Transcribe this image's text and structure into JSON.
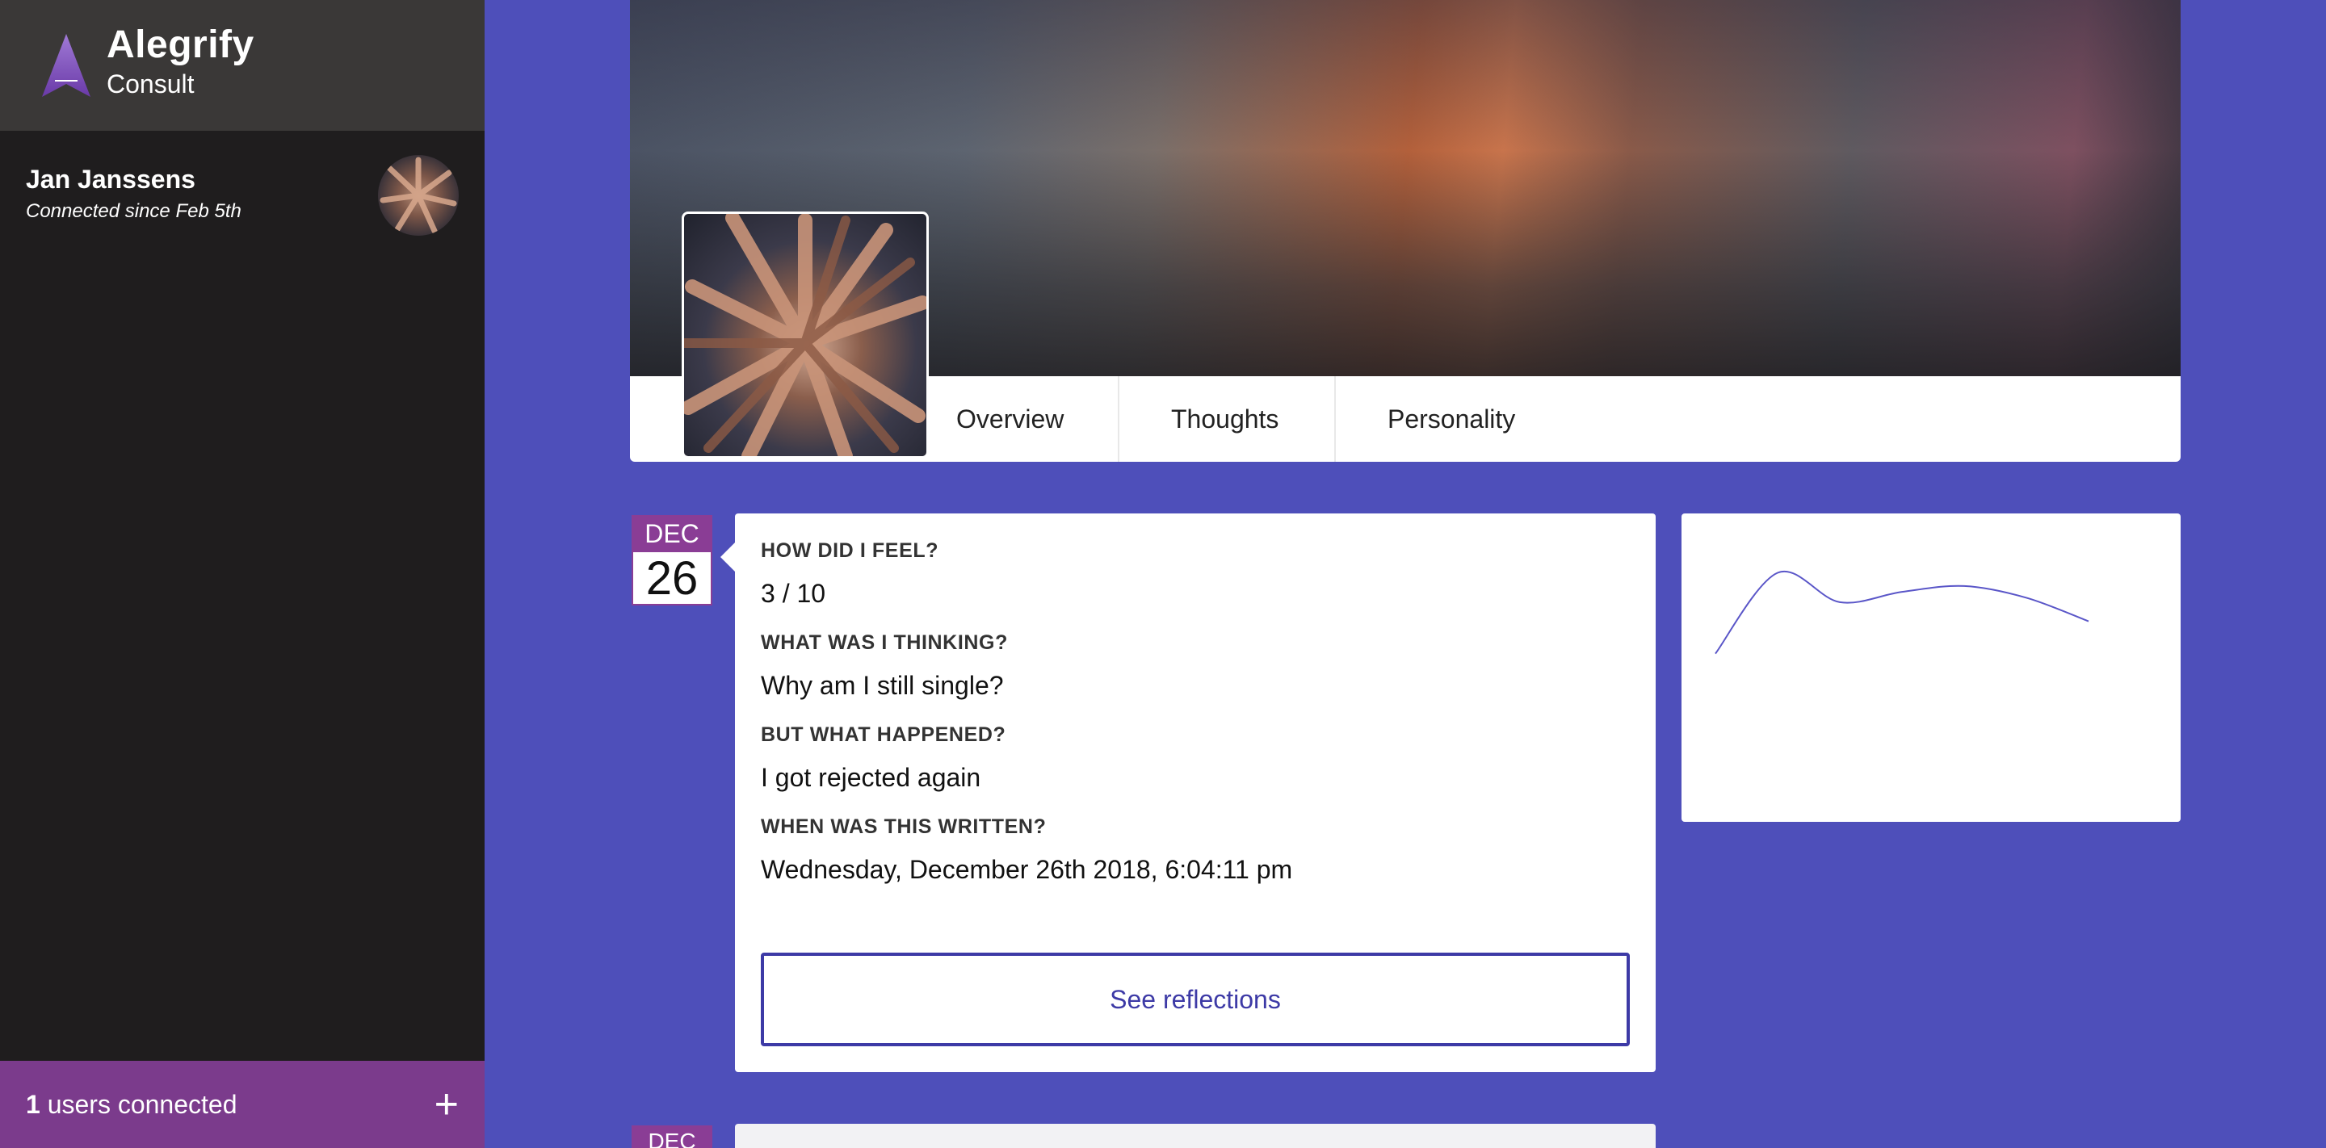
{
  "sidebar": {
    "brand": {
      "name": "Alegrify",
      "subtitle": "Consult"
    },
    "user": {
      "name": "Jan Janssens",
      "since": "Connected since Feb 5th"
    },
    "footer": {
      "count": "1",
      "label": " users connected",
      "add_icon": "plus-icon"
    }
  },
  "profile": {
    "tabs": [
      {
        "label": "Overview"
      },
      {
        "label": "Thoughts"
      },
      {
        "label": "Personality"
      }
    ]
  },
  "entry": {
    "date": {
      "month": "DEC",
      "day": "26"
    },
    "questions": [
      {
        "label": "HOW DID I FEEL?",
        "value": "3 / 10"
      },
      {
        "label": "WHAT WAS I THINKING?",
        "value": "Why am I still single?"
      },
      {
        "label": "BUT WHAT HAPPENED?",
        "value": "I got rejected again"
      },
      {
        "label": "WHEN WAS THIS WRITTEN?",
        "value": "Wednesday, December 26th 2018, 6:04:11 pm"
      }
    ],
    "button_label": "See reflections"
  },
  "next_entry": {
    "month": "DEC"
  },
  "colors": {
    "accent": "#4e4fba",
    "purple": "#8a3d95",
    "sidebar": "#1f1d1e",
    "button": "#3d3aa6"
  },
  "chart_data": {
    "type": "line",
    "title": "",
    "xlabel": "",
    "ylabel": "",
    "x": [
      0,
      1,
      2,
      3,
      4,
      5,
      6
    ],
    "series": [
      {
        "values": [
          2,
          7.5,
          5.5,
          6.2,
          6.6,
          5.8,
          4.2
        ]
      }
    ],
    "ylim": [
      0,
      10
    ],
    "grid": false,
    "color": "#5a56c8"
  }
}
